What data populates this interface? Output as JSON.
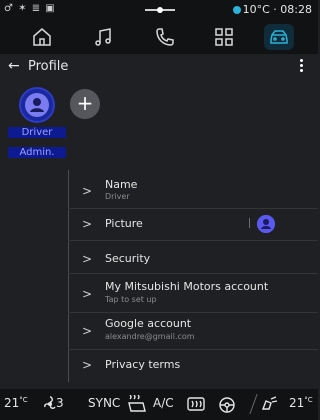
{
  "status_bar": {
    "left_icons": "♂ ✶ ≣ ▣",
    "temperature": "10°C",
    "separator": "·",
    "time": "08:28"
  },
  "nav": {
    "items": [
      {
        "icon": "home-icon"
      },
      {
        "icon": "music-icon"
      },
      {
        "icon": "phone-icon"
      },
      {
        "icon": "apps-grid-icon"
      },
      {
        "icon": "car-icon",
        "active": true
      }
    ]
  },
  "header": {
    "back": "←",
    "title": "Profile"
  },
  "profiles": {
    "driver_label_1": "Driver",
    "driver_label_2": "Admin.",
    "add": "+"
  },
  "menu": {
    "chevron": ">",
    "items": [
      {
        "label": "Name",
        "sub": "Driver"
      },
      {
        "label": "Picture"
      },
      {
        "label": "Security"
      },
      {
        "label": "My Mitsubishi Motors account",
        "sub": "Tap to set up"
      },
      {
        "label": "Google account",
        "sub": "alexandre@gmail.com"
      },
      {
        "label": "Privacy terms"
      }
    ]
  },
  "bottom_bar": {
    "temp_left": "21",
    "temp_right": "21",
    "deg": "°C",
    "fan": "3",
    "sync": "SYNC",
    "ac": "A/C"
  },
  "colors": {
    "background": "#1f2023",
    "bar": "#111214",
    "accent": "#2bb3d9",
    "selection": "#0e1a8f"
  }
}
